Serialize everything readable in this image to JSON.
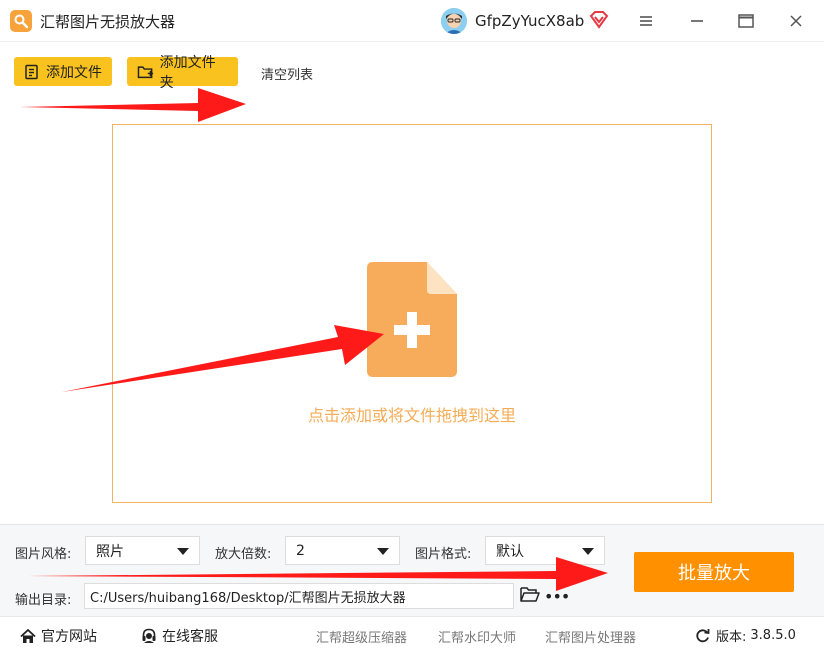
{
  "app": {
    "title": "汇帮图片无损放大器"
  },
  "user": {
    "name": "GfpZyYucX8ab"
  },
  "toolbar": {
    "add_file": "添加文件",
    "add_folder": "添加文件夹",
    "clear_list": "清空列表"
  },
  "dropzone": {
    "hint": "点击添加或将文件拖拽到这里"
  },
  "settings": {
    "style_label": "图片风格:",
    "style_value": "照片",
    "scale_label": "放大倍数:",
    "scale_value": "2",
    "format_label": "图片格式:",
    "format_value": "默认",
    "output_label": "输出目录:",
    "output_path": "C:/Users/huibang168/Desktop/汇帮图片无损放大器",
    "more": "•••",
    "batch_button": "批量放大"
  },
  "footer": {
    "website": "官方网站",
    "support": "在线客服",
    "link1": "汇帮超级压缩器",
    "link2": "汇帮水印大师",
    "link3": "汇帮图片处理器",
    "version_label": "版本:",
    "version_value": "3.8.5.0"
  },
  "colors": {
    "accent": "#ff9000",
    "toolbar_button": "#f9c21e",
    "dropzone_border": "#f0b463",
    "file_icon": "#f7ac5c",
    "annotation_arrow": "#ff1a1a"
  },
  "icons": [
    "magnifier-logo-icon",
    "avatar",
    "vip-diamond-icon",
    "menu-icon",
    "maximize-icon",
    "close-icon",
    "add-file-icon",
    "add-folder-icon",
    "file-plus-icon",
    "folder-open-icon",
    "home-icon",
    "headset-icon",
    "refresh-icon"
  ]
}
